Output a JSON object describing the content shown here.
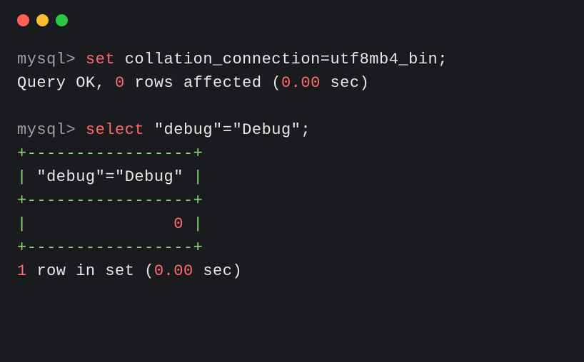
{
  "window": {
    "dots": [
      "red",
      "yellow",
      "green"
    ]
  },
  "terminal": {
    "lines": {
      "l1_prompt": "mysql> ",
      "l1_kw": "set",
      "l1_rest": " collation_connection=utf8mb4_bin;",
      "l2_a": "Query OK, ",
      "l2_num": "0",
      "l2_b": " rows affected (",
      "l2_time": "0.00",
      "l2_c": " sec)",
      "l3_prompt": "mysql> ",
      "l3_kw": "select",
      "l3_rest": " \"debug\"=\"Debug\";",
      "border_top": "+-----------------+",
      "header_pipe1": "|",
      "header_text": " \"debug\"=\"Debug\" ",
      "header_pipe2": "|",
      "border_mid": "+-----------------+",
      "row_pipe1": "|",
      "row_pad1": "               ",
      "row_val": "0",
      "row_pad2": " ",
      "row_pipe2": "|",
      "border_bot": "+-----------------+",
      "footer_one": "1",
      "footer_a": " row in set (",
      "footer_time": "0.00",
      "footer_b": " sec)"
    }
  }
}
